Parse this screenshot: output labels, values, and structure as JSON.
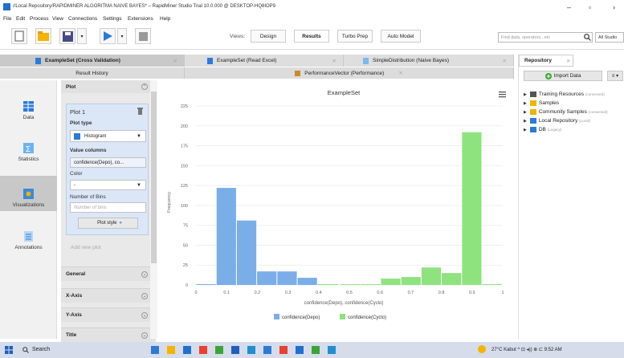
{
  "window": {
    "title": "//Local Repository/RAPIDMINER ALGORITMA NAIVE BAYES* – RapidMiner Studio Trial 10.0.000 @ DESKTOP-HQ8IOP9",
    "minimize": "–",
    "maximize": "▫",
    "close": "›"
  },
  "menu": [
    "File",
    "Edit",
    "Process",
    "View",
    "Connections",
    "Settings",
    "Extensions",
    "Help"
  ],
  "toolbar": {
    "views_label": "Views:",
    "views": [
      "Design",
      "Results",
      "Turbo Prep",
      "Auto Model"
    ],
    "active_view": "Results",
    "search_placeholder": "Find data, operators...etc",
    "search_scope": "All Studio"
  },
  "tabs": [
    {
      "label": "ExampleSet (Cross Validation)",
      "active": true
    },
    {
      "label": "ExampleSet (Read Excel)",
      "active": false
    },
    {
      "label": "SimpleDistribution (Naive Bayes)",
      "active": false
    }
  ],
  "subtabs": [
    "Result History",
    "PerformanceVector (Performance)"
  ],
  "leftnav": [
    "Data",
    "Statistics",
    "Visualizations",
    "Annotations"
  ],
  "panel": {
    "plot_header": "Plot",
    "plot_name": "Plot 1",
    "plot_type_label": "Plot type",
    "plot_type_value": "Histogram",
    "value_columns_label": "Value columns",
    "value_columns_value": "confidence(Depo), co...",
    "color_label": "Color",
    "color_value": "-",
    "bins_label": "Number of Bins",
    "bins_placeholder": "Number of bins",
    "plot_style": "Plot style",
    "add_new_plot": "Add new plot",
    "sections": [
      "General",
      "X-Axis",
      "Y-Axis",
      "Title"
    ]
  },
  "chart_data": {
    "type": "bar",
    "title": "ExampleSet",
    "xlabel": "confidence(Depo), confidence(Cyclo)",
    "ylabel": "Frequency",
    "xlim": [
      0,
      1
    ],
    "ylim": [
      0,
      225
    ],
    "yticks": [
      0,
      25,
      50,
      75,
      100,
      125,
      150,
      175,
      200,
      225
    ],
    "xticks": [
      "0",
      "0.1",
      "0.2",
      "0.3",
      "0.4",
      "0.5",
      "0.6",
      "0.7",
      "0.8",
      "0.9",
      "1"
    ],
    "bin_width": 0.066,
    "series": [
      {
        "name": "confidence(Depo)",
        "color": "#7aaee8",
        "bins": [
          {
            "x0": 0.0,
            "value": 1
          },
          {
            "x0": 0.066,
            "value": 122
          },
          {
            "x0": 0.132,
            "value": 81
          },
          {
            "x0": 0.198,
            "value": 17
          },
          {
            "x0": 0.264,
            "value": 17
          },
          {
            "x0": 0.33,
            "value": 9
          },
          {
            "x0": 0.396,
            "value": 1
          }
        ]
      },
      {
        "name": "confidence(Cyclo)",
        "color": "#8fe37e",
        "bins": [
          {
            "x0": 0.4,
            "value": 1
          },
          {
            "x0": 0.47,
            "value": 1
          },
          {
            "x0": 0.536,
            "value": 1
          },
          {
            "x0": 0.602,
            "value": 8
          },
          {
            "x0": 0.668,
            "value": 10
          },
          {
            "x0": 0.734,
            "value": 22
          },
          {
            "x0": 0.8,
            "value": 15
          },
          {
            "x0": 0.866,
            "value": 192
          },
          {
            "x0": 0.932,
            "value": 1
          }
        ]
      }
    ],
    "legend": "bottom-center"
  },
  "repository": {
    "tab": "Repository",
    "import_button": "Import Data",
    "more": "≡ ▾",
    "items": [
      {
        "label": "Training Resources",
        "sub": "(connected)",
        "color": "#555"
      },
      {
        "label": "Samples",
        "sub": "",
        "color": "#f0b400"
      },
      {
        "label": "Community Samples",
        "sub": "(connected)",
        "color": "#f0b400"
      },
      {
        "label": "Local Repository",
        "sub": "(Local)",
        "color": "#2a7bd8"
      },
      {
        "label": "DB",
        "sub": "(Legacy)",
        "color": "#2a7bd8"
      }
    ]
  },
  "taskbar": {
    "search": "Search",
    "tray": "27°C Kabut   ^  ⊡  ◂))  ⊕  ⊏  9:52 AM"
  }
}
